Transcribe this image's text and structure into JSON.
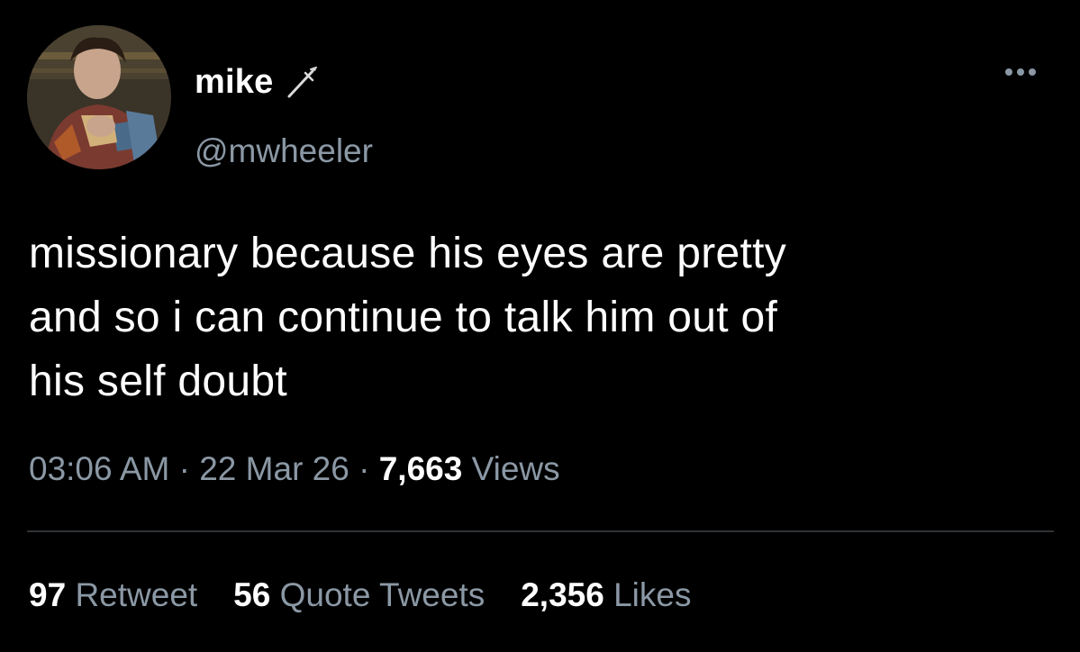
{
  "author": {
    "display_name": "mike",
    "name_icon": "dagger-icon",
    "handle": "@mwheeler",
    "avatar_icon": "profile-photo"
  },
  "tweet": {
    "line1": "missionary because his eyes are pretty",
    "line2": "and so i can continue to talk him out of",
    "line3": "his self doubt"
  },
  "meta": {
    "time": "03:06 AM",
    "separator": "·",
    "date": "22 Mar 26",
    "views_count": "7,663",
    "views_label": "Views"
  },
  "stats": {
    "retweets_count": "97",
    "retweets_label": "Retweet",
    "quotes_count": "56",
    "quotes_label": "Quote Tweets",
    "likes_count": "2,356",
    "likes_label": "Likes"
  },
  "colors": {
    "background": "#000000",
    "primary_text": "#ffffff",
    "secondary_text": "#8b98a5",
    "divider": "#2f3336"
  },
  "more_icon": "more-options-icon"
}
